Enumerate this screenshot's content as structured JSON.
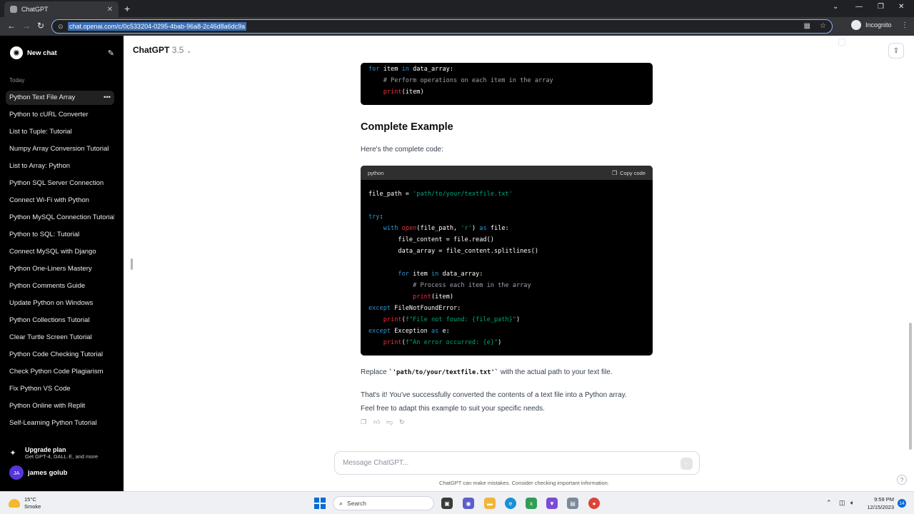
{
  "browser": {
    "tab_title": "ChatGPT",
    "url": "chat.openai.com/c/0c533204-0295-4bab-96a8-2c46d8a6dc9a",
    "profile_label": "Incognito"
  },
  "sidebar": {
    "new_chat_label": "New chat",
    "section_label": "Today",
    "chats": [
      {
        "label": "Python Text File Array"
      },
      {
        "label": "Python to cURL Converter"
      },
      {
        "label": "List to Tuple: Tutorial"
      },
      {
        "label": "Numpy Array Conversion Tutorial"
      },
      {
        "label": "List to Array: Python"
      },
      {
        "label": "Python SQL Server Connection"
      },
      {
        "label": "Connect Wi-Fi with Python"
      },
      {
        "label": "Python MySQL Connection Tutorial"
      },
      {
        "label": "Python to SQL: Tutorial"
      },
      {
        "label": "Connect MySQL with Django"
      },
      {
        "label": "Python One-Liners Mastery"
      },
      {
        "label": "Python Comments Guide"
      },
      {
        "label": "Update Python on Windows"
      },
      {
        "label": "Python Collections Tutorial"
      },
      {
        "label": "Clear Turtle Screen Tutorial"
      },
      {
        "label": "Python Code Checking Tutorial"
      },
      {
        "label": "Check Python Code Plagiarism"
      },
      {
        "label": "Fix Python VS Code"
      },
      {
        "label": "Python Online with Replit"
      },
      {
        "label": "Self-Learning Python Tutorial"
      }
    ],
    "upgrade_title": "Upgrade plan",
    "upgrade_subtitle": "Get GPT-4, DALL·E, and more",
    "user_initials": "JA",
    "user_name": "james golub"
  },
  "header": {
    "model_name": "ChatGPT",
    "model_version": "3.5"
  },
  "message": {
    "top_code_lines": [
      "for item in data_array:",
      "    # Perform operations on each item in the array",
      "    print(item)"
    ],
    "heading": "Complete Example",
    "intro": "Here's the complete code:",
    "code_language": "python",
    "copy_label": "Copy code",
    "code_lines": [
      "file_path = 'path/to/your/textfile.txt'",
      "",
      "try:",
      "    with open(file_path, 'r') as file:",
      "        file_content = file.read()",
      "        data_array = file_content.splitlines()",
      "",
      "        for item in data_array:",
      "            # Process each item in the array",
      "            print(item)",
      "except FileNotFoundError:",
      "    print(f\"File not found: {file_path}\")",
      "except Exception as e:",
      "    print(f\"An error occurred: {e}\")"
    ],
    "replace_prefix": "Replace ",
    "replace_code": "`'path/to/your/textfile.txt'`",
    "replace_suffix": " with the actual path to your text file.",
    "closing_line1": "That's it! You've successfully converted the contents of a text file into a Python array.",
    "closing_line2": "Feel free to adapt this example to suit your specific needs."
  },
  "composer": {
    "placeholder": "Message ChatGPT...",
    "disclaimer": "ChatGPT can make mistakes. Consider checking important information.",
    "help_label": "?"
  },
  "taskbar": {
    "temperature": "15°C",
    "weather": "Smoke",
    "search_label": "Search",
    "time": "9:59 PM",
    "date": "12/15/2023",
    "notification_count": "14"
  },
  "colors": {
    "sidebar_bg": "#000000",
    "code_bg": "#000000",
    "keyword": "#2e95d3",
    "function": "#f22c3d",
    "string": "#00a67d",
    "comment": "#9ca3af"
  }
}
